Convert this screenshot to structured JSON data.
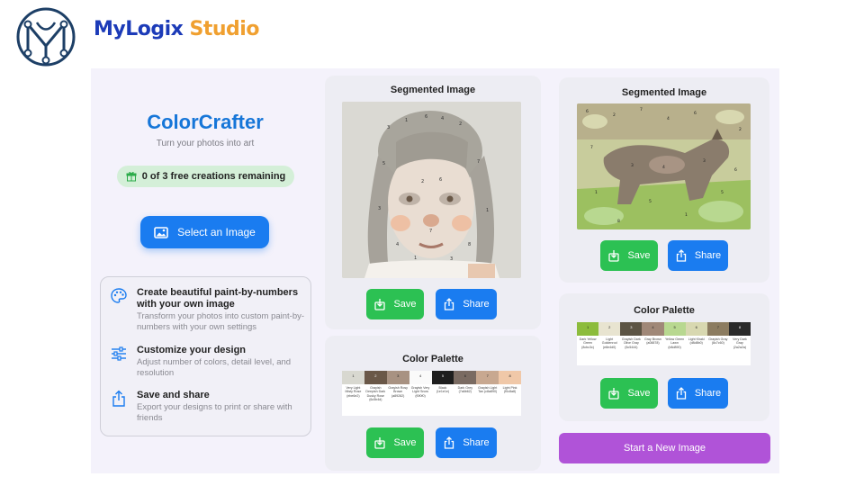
{
  "brand": {
    "name_main": "MyLogix",
    "name_accent": "Studio",
    "color_main": "#1c3bb8",
    "color_accent": "#f0a030"
  },
  "left_panel": {
    "title": "ColorCrafter",
    "subtitle": "Turn your photos into art",
    "badge_text": "0 of 3 free creations remaining",
    "badge_icon": "gift-icon",
    "select_button_label": "Select an Image",
    "select_button_icon": "image-icon",
    "features": [
      {
        "icon": "palette-icon",
        "title": "Create beautiful paint-by-numbers with your own image",
        "desc": "Transform your photos into custom paint-by-numbers with your own settings"
      },
      {
        "icon": "sliders-icon",
        "title": "Customize your design",
        "desc": "Adjust number of colors, detail level, and resolution"
      },
      {
        "icon": "share-icon",
        "title": "Save and share",
        "desc": "Export your designs to print or share with friends"
      }
    ]
  },
  "panel_middle": {
    "segmented_title": "Segmented Image",
    "save_label": "Save",
    "share_label": "Share",
    "palette_title": "Color Palette",
    "palette_save_label": "Save",
    "palette_share_label": "Share",
    "palette": [
      {
        "num": "1",
        "color": "#d8d8d0",
        "name": "Very Light Misty Rose (ebe6e2)"
      },
      {
        "num": "2",
        "color": "#6a5848",
        "name": "Grayish Deepish Dark Dusky Rose (6c5b4d)"
      },
      {
        "num": "3",
        "color": "#a89282",
        "name": "Grayish Rosy Brown (a89282)"
      },
      {
        "num": "4",
        "color": "#fafafa",
        "name": "Grayish Very Light Snow (f0f0f0)"
      },
      {
        "num": "5",
        "color": "#1e1e1e",
        "name": "Black (1e1e1e)"
      },
      {
        "num": "6",
        "color": "#7a6b62",
        "name": "Dark Grey (7a6b62)"
      },
      {
        "num": "7",
        "color": "#c8a890",
        "name": "Grayish Light Tan (c8a890)"
      },
      {
        "num": "8",
        "color": "#f0c8a8",
        "name": "Light Pink (f0c8a8)"
      }
    ]
  },
  "panel_right": {
    "segmented_title": "Segmented Image",
    "save_label": "Save",
    "share_label": "Share",
    "palette_title": "Color Palette",
    "palette_save_label": "Save",
    "palette_share_label": "Share",
    "new_image_label": "Start a New Image",
    "palette": [
      {
        "num": "1",
        "color": "#8cbc3c",
        "name": "Dark Yellow Green (8cbc3c)"
      },
      {
        "num": "2",
        "color": "#e8e4d0",
        "name": "Light Goldenrod (e8e4d0)"
      },
      {
        "num": "3",
        "color": "#5c5444",
        "name": "Grayish Dark Olive Gray (5c5444)"
      },
      {
        "num": "4",
        "color": "#a08878",
        "name": "Gray Brown (a08878)"
      },
      {
        "num": "5",
        "color": "#b8d890",
        "name": "Yellow Green Lawn (b8d890)"
      },
      {
        "num": "6",
        "color": "#d8d8b0",
        "name": "Light Khaki (d8d8b0)"
      },
      {
        "num": "7",
        "color": "#8c7c60",
        "name": "Grayish Gray (8c7c60)"
      },
      {
        "num": "8",
        "color": "#2a2a2a",
        "name": "Very Dark Gray (2a2a2a)"
      }
    ]
  }
}
